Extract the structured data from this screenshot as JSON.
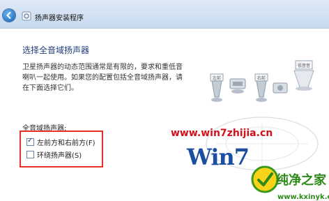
{
  "window": {
    "title": "扬声器安装程序"
  },
  "icons": {
    "back": "back-arrow-icon",
    "speaker": "speaker-icon"
  },
  "main": {
    "heading": "选择全音域扬声器",
    "description": "卫星扬声器的动态范围通常是有限的，要求和重低音喇叭一起使用。如果您的配置包括全音域扬声器，请在下面选择它们。",
    "group_label": "全音域扬声器:",
    "options": [
      {
        "label": "左前方和右前方(F)",
        "checked": true
      },
      {
        "label": "环绕扬声器(S)",
        "checked": false
      }
    ]
  },
  "diagram": {
    "labels": [
      "左前",
      "右前",
      "低音音"
    ]
  },
  "watermark": {
    "site": "www.win7zhijia.cn",
    "logo": "Win7",
    "brand": "纯净之家",
    "brand_url": "www.kxinyk.com"
  },
  "colors": {
    "accent": "#1f3d7a",
    "highlight_box": "#e53228",
    "watermark_red": "#d0101a",
    "brand_green": "#2d8a1a"
  }
}
